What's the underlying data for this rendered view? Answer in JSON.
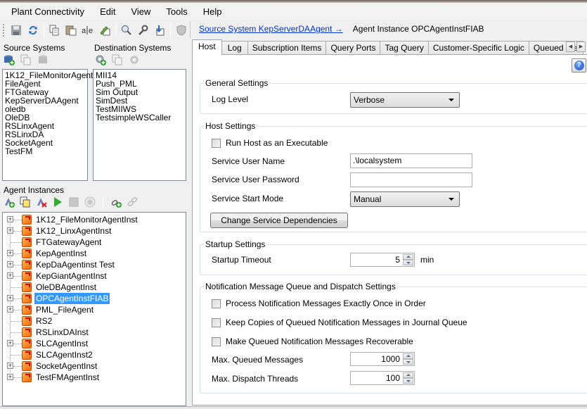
{
  "menu": [
    "Plant Connectivity",
    "Edit",
    "View",
    "Tools",
    "Help"
  ],
  "toolbar": {
    "icons": [
      "save-icon",
      "refresh-icon",
      "copy-icon",
      "paste-icon",
      "rename-icon",
      "edit-icon",
      "search-icon",
      "settings-wrench-icon",
      "import-icon",
      "security-shield-icon"
    ]
  },
  "breadcrumb": {
    "link": "Source System KepServerDAAgent →",
    "current": "Agent Instance OPCAgentInstFIAB"
  },
  "source_systems": {
    "title": "Source Systems",
    "icons": [
      "add-source-icon",
      "copy-source-icon",
      "delete-source-icon"
    ],
    "items": [
      "1K12_FileMonitorAgent",
      "FileAgent",
      "FTGateway",
      "KepServerDAAgent",
      "oledb",
      "OleDB",
      "RSLinxAgent",
      "RSLinxDA",
      "SocketAgent",
      "TestFM"
    ]
  },
  "destination_systems": {
    "title": "Destination Systems",
    "icons": [
      "add-destination-icon",
      "copy-destination-icon",
      "delete-destination-icon"
    ],
    "items": [
      "MII14",
      "Push_PML",
      "Sim Output",
      "SimDest",
      "TestMIIWS",
      "TestsimpleWSCaller"
    ]
  },
  "agent_instances": {
    "title": "Agent Instances",
    "icons": [
      "add-agent-icon",
      "copy-agent-icon",
      "delete-agent-icon",
      "start-icon",
      "stop-icon",
      "restart-icon",
      "add-link-icon",
      "remove-link-icon"
    ],
    "items": [
      {
        "label": "1K12_FileMonitorAgentInst",
        "expandable": true,
        "selected": false
      },
      {
        "label": "1K12_LinxAgentInst",
        "expandable": true,
        "selected": false
      },
      {
        "label": "FTGatewayAgent",
        "expandable": false,
        "selected": false
      },
      {
        "label": "KepAgentInst",
        "expandable": true,
        "selected": false
      },
      {
        "label": "KepDaAgentinst Test",
        "expandable": true,
        "selected": false
      },
      {
        "label": "KepGiantAgentInst",
        "expandable": true,
        "selected": false
      },
      {
        "label": "OleDBAgentInst",
        "expandable": false,
        "selected": false
      },
      {
        "label": "OPCAgentInstFIAB",
        "expandable": true,
        "selected": true
      },
      {
        "label": "PML_FileAgent",
        "expandable": true,
        "selected": false
      },
      {
        "label": "RS2",
        "expandable": false,
        "selected": false
      },
      {
        "label": "RSLinxDAInst",
        "expandable": false,
        "selected": false
      },
      {
        "label": "SLCAgentInst",
        "expandable": true,
        "selected": false
      },
      {
        "label": "SLCAgentInst2",
        "expandable": false,
        "selected": false
      },
      {
        "label": "SocketAgentInst",
        "expandable": true,
        "selected": false
      },
      {
        "label": "TestFMAgentInst",
        "expandable": true,
        "selected": false
      }
    ]
  },
  "tabs": [
    "Host",
    "Log",
    "Subscription Items",
    "Query Ports",
    "Tag Query",
    "Customer-Specific Logic",
    "Queued Messages"
  ],
  "active_tab": "Host",
  "host": {
    "general": {
      "title": "General Settings",
      "log_level_label": "Log Level",
      "log_level_value": "Verbose"
    },
    "host_settings": {
      "title": "Host Settings",
      "run_as_exe_label": "Run Host as an Executable",
      "run_as_exe_checked": false,
      "user_name_label": "Service User Name",
      "user_name_value": ".\\localsystem",
      "password_label": "Service User Password",
      "password_value": "",
      "start_mode_label": "Service Start Mode",
      "start_mode_value": "Manual",
      "dependencies_button": "Change Service Dependencies"
    },
    "startup": {
      "title": "Startup Settings",
      "timeout_label": "Startup Timeout",
      "timeout_value": "5",
      "timeout_unit": "min"
    },
    "notification": {
      "title": "Notification Message Queue and Dispatch Settings",
      "cb1_label": "Process Notification Messages Exactly Once in Order",
      "cb2_label": "Keep Copies of Queued Notification Messages in Journal Queue",
      "cb3_label": "Make Queued Notification Messages Recoverable",
      "max_queued_label": "Max. Queued Messages",
      "max_queued_value": "1000",
      "max_threads_label": "Max. Dispatch Threads",
      "max_threads_value": "100"
    }
  }
}
